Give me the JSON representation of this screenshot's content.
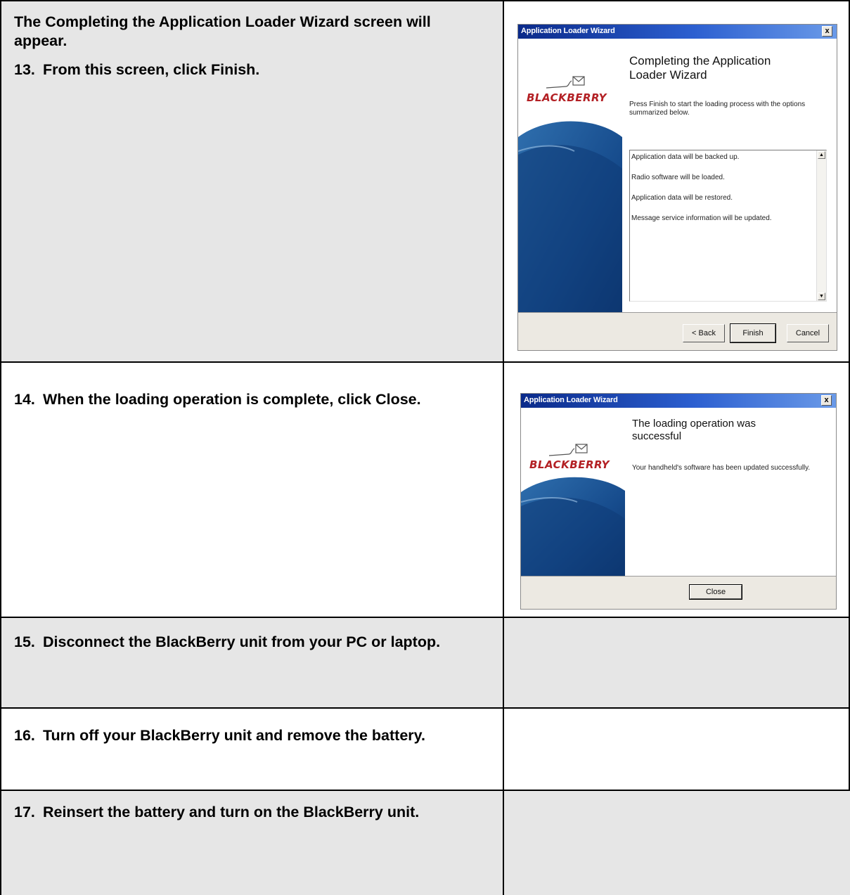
{
  "rows": [
    {
      "intro": "The Completing the Application Loader Wizard screen will appear.",
      "step_num": "13.",
      "step_text": "From this screen, click Finish.",
      "dialog": {
        "title": "Application Loader Wizard",
        "close_glyph": "x",
        "heading": "Completing the Application Loader Wizard",
        "logo": "BLACKBERRY",
        "description": "Press Finish to start the loading process with the options summarized below.",
        "list_items": [
          "Application data will be backed up.",
          "Radio software will be loaded.",
          "Application data will be restored.",
          "Message service information will be updated."
        ],
        "buttons": {
          "back": "< Back",
          "finish": "Finish",
          "cancel": "Cancel"
        }
      }
    },
    {
      "step_num": "14.",
      "step_text": "When the loading operation is complete, click Close.",
      "dialog": {
        "title": "Application Loader Wizard",
        "close_glyph": "x",
        "heading": "The loading operation was successful",
        "logo": "BLACKBERRY",
        "description": "Your handheld's software has been updated successfully.",
        "buttons": {
          "close": "Close"
        }
      }
    },
    {
      "step_num": "15.",
      "step_text": "Disconnect the BlackBerry unit from your PC or laptop."
    },
    {
      "step_num": "16.",
      "step_text": "Turn off your BlackBerry unit and remove the battery."
    },
    {
      "step_num": "17.",
      "step_text": "Reinsert the battery and turn on the BlackBerry unit."
    }
  ],
  "colors": {
    "gray_cell": "#e6e6e6",
    "logo_red": "#b32024",
    "title_blue": "#0a2a8a"
  }
}
